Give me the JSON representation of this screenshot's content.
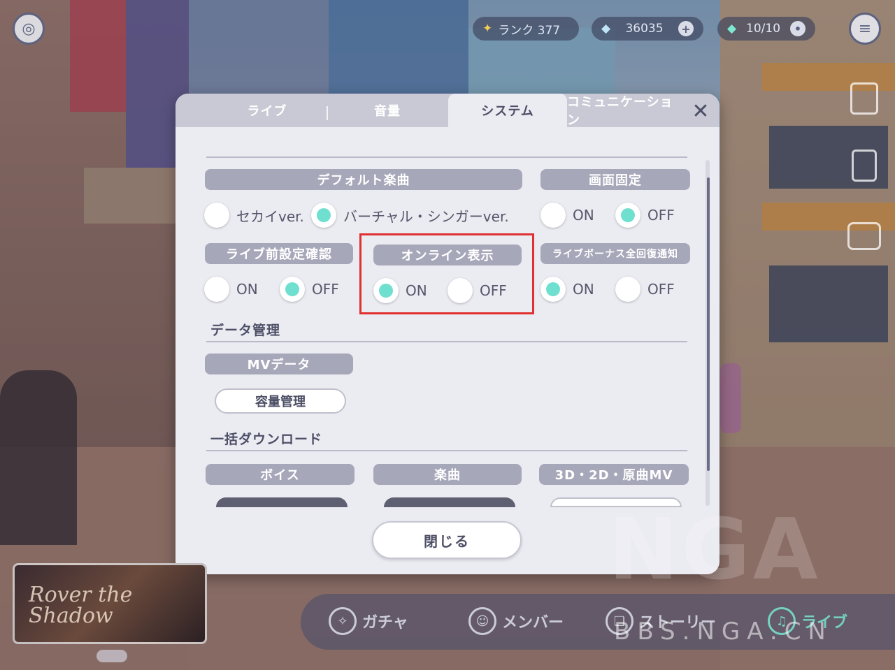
{
  "hud": {
    "rank_label": "ランク 377",
    "crystals": "36035",
    "live_energy": "10/10"
  },
  "dialog": {
    "tabs": [
      {
        "label": "ライブ",
        "active": false
      },
      {
        "label": "音量",
        "active": false
      },
      {
        "label": "システム",
        "active": true
      },
      {
        "label": "コミュニケーション",
        "active": false
      }
    ],
    "close_icon": "✕",
    "default_song": {
      "header": "デフォルト楽曲",
      "options": [
        {
          "label": "セカイver.",
          "selected": false
        },
        {
          "label": "バーチャル・シンガーver.",
          "selected": true
        }
      ]
    },
    "screen_lock": {
      "header": "画面固定",
      "options": [
        {
          "label": "ON",
          "selected": false
        },
        {
          "label": "OFF",
          "selected": true
        }
      ]
    },
    "pre_live_check": {
      "header": "ライブ前設定確認",
      "options": [
        {
          "label": "ON",
          "selected": false
        },
        {
          "label": "OFF",
          "selected": true
        }
      ]
    },
    "online_display": {
      "header": "オンライン表示",
      "options": [
        {
          "label": "ON",
          "selected": true
        },
        {
          "label": "OFF",
          "selected": false
        }
      ]
    },
    "live_bonus_notify": {
      "header": "ライブボーナス全回復通知",
      "options": [
        {
          "label": "ON",
          "selected": true
        },
        {
          "label": "OFF",
          "selected": false
        }
      ]
    },
    "data_management": {
      "title": "データ管理",
      "mv_header": "MVデータ",
      "capacity_button": "容量管理"
    },
    "bulk_download": {
      "title": "一括ダウンロード",
      "voice_header": "ボイス",
      "songs_header": "楽曲",
      "mv_header": "3D・2D・原曲MV"
    },
    "close_button": "閉じる"
  },
  "nav": {
    "gacha": "ガチャ",
    "member": "メンバー",
    "story": "ストーリー",
    "live": "ライブ"
  },
  "thumbnail_text": "Rover the Shadow",
  "watermark": {
    "big": "NGA",
    "url": "BBS.NGA.CN"
  },
  "colors": {
    "accent_radio": "#6fe0cf",
    "header_bg": "#a7a7ba",
    "highlight_box": "#e03030"
  }
}
